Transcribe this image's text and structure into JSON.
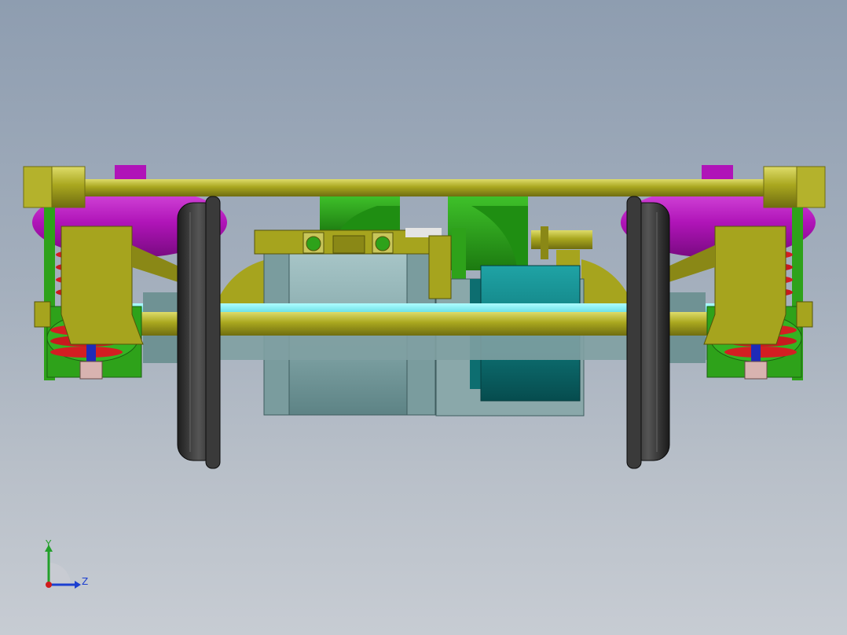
{
  "scene": {
    "kind": "cad-model-viewport",
    "background": {
      "top_color": "#8e9db0",
      "bottom_color": "#c7ccd3"
    },
    "colors": {
      "frame_olive": "#a6a41e",
      "frame_olive_dark": "#6f6d10",
      "air_spring_magenta": "#b014b8",
      "coil_spring_red": "#d31e22",
      "bracket_green": "#2ea21a",
      "motor_grey_teal": "#8fb3b4",
      "gearbox_teal": "#138a8c",
      "axle_cyan": "#7ff0f4",
      "wheel_dark": "#2a2a2a"
    }
  },
  "triad": {
    "y_label": "Y",
    "z_label": "Z",
    "y_color": "#22a02a",
    "z_color": "#1c3fd0",
    "x_color": "#d01c1c"
  }
}
